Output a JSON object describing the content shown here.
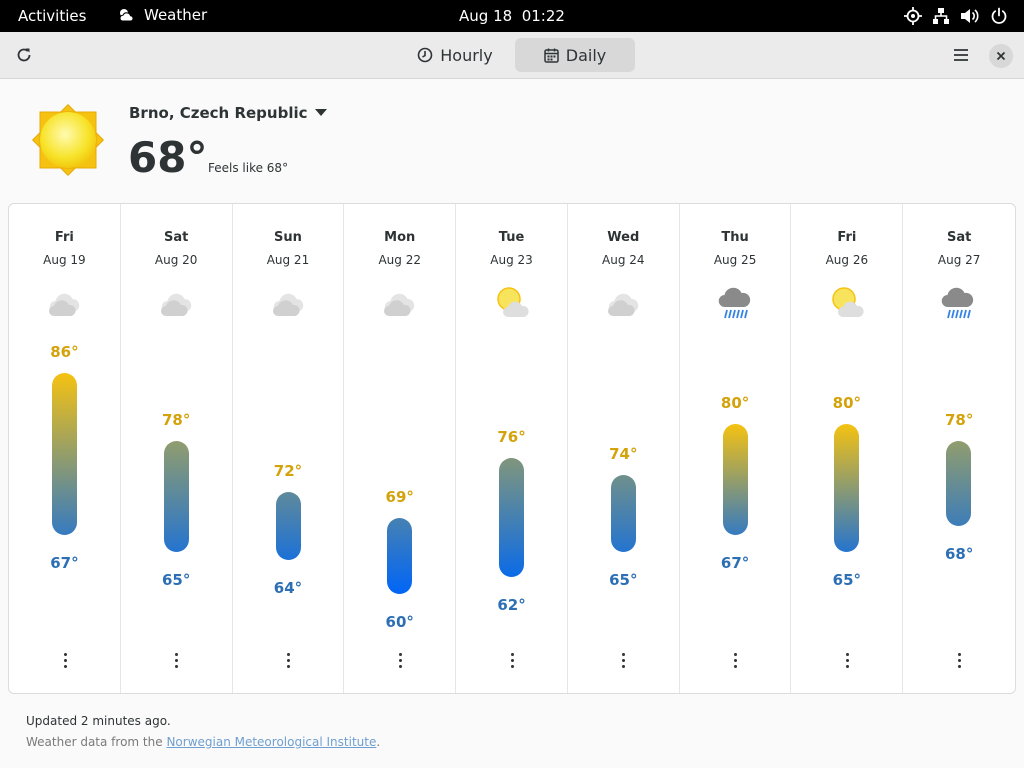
{
  "topbar": {
    "activities": "Activities",
    "app_name": "Weather",
    "clock": "Aug 18  01:22"
  },
  "header": {
    "tabs": [
      {
        "label": "Hourly",
        "icon": "clock-icon",
        "active": false
      },
      {
        "label": "Daily",
        "icon": "calendar-icon",
        "active": true
      }
    ]
  },
  "current": {
    "location": "Brno, Czech Republic",
    "temperature": "68°",
    "feels_like": "Feels like 68°",
    "condition_icon": "sun-icon"
  },
  "forecast": [
    {
      "day": "Fri",
      "date": "Aug 19",
      "icon": "cloudy",
      "high": "86°",
      "low": "67°",
      "high_value": 86,
      "low_value": 67
    },
    {
      "day": "Sat",
      "date": "Aug 20",
      "icon": "cloudy",
      "high": "78°",
      "low": "65°",
      "high_value": 78,
      "low_value": 65
    },
    {
      "day": "Sun",
      "date": "Aug 21",
      "icon": "cloudy",
      "high": "72°",
      "low": "64°",
      "high_value": 72,
      "low_value": 64
    },
    {
      "day": "Mon",
      "date": "Aug 22",
      "icon": "cloudy",
      "high": "69°",
      "low": "60°",
      "high_value": 69,
      "low_value": 60
    },
    {
      "day": "Tue",
      "date": "Aug 23",
      "icon": "partly-cloudy",
      "high": "76°",
      "low": "62°",
      "high_value": 76,
      "low_value": 62
    },
    {
      "day": "Wed",
      "date": "Aug 24",
      "icon": "cloudy",
      "high": "74°",
      "low": "65°",
      "high_value": 74,
      "low_value": 65
    },
    {
      "day": "Thu",
      "date": "Aug 25",
      "icon": "rain",
      "high": "80°",
      "low": "67°",
      "high_value": 80,
      "low_value": 67
    },
    {
      "day": "Fri",
      "date": "Aug 26",
      "icon": "partly-cloudy",
      "high": "80°",
      "low": "65°",
      "high_value": 80,
      "low_value": 65
    },
    {
      "day": "Sat",
      "date": "Aug 27",
      "icon": "rain",
      "high": "78°",
      "low": "68°",
      "high_value": 78,
      "low_value": 68
    }
  ],
  "footer": {
    "updated": "Updated 2 minutes ago.",
    "source_prefix": "Weather data from the ",
    "source_link": "Norwegian Meteorological Institute",
    "source_suffix": "."
  },
  "colors": {
    "high": "#d4a20a",
    "low": "#2d6fb5",
    "topbar": "#000000",
    "link": "#6f9fd0"
  }
}
